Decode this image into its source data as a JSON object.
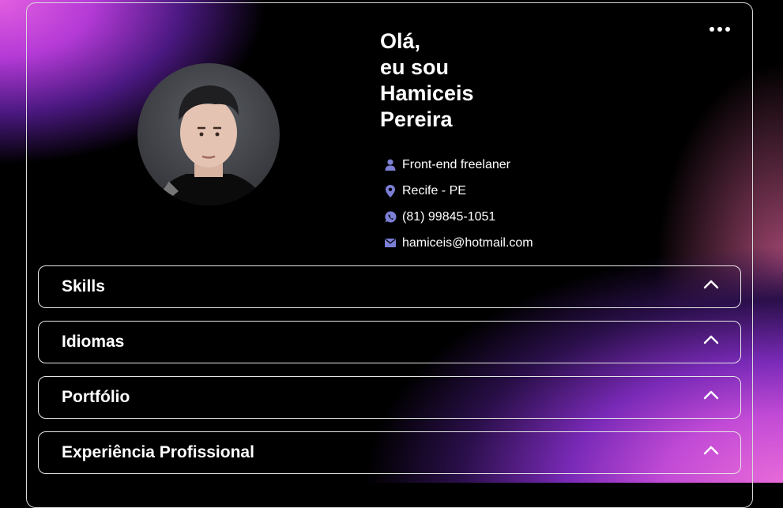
{
  "profile": {
    "greeting_lines": [
      "Olá,",
      "eu sou",
      "Hamiceis",
      "Pereira"
    ],
    "info": [
      {
        "icon": "person-icon",
        "text": "Front-end freelaner"
      },
      {
        "icon": "location-pin-icon",
        "text": "Recife - PE"
      },
      {
        "icon": "whatsapp-icon",
        "text": "(81) 99845-1051"
      },
      {
        "icon": "mail-icon",
        "text": "hamiceis@hotmail.com"
      }
    ]
  },
  "sections": [
    {
      "label": "Skills"
    },
    {
      "label": "Idiomas"
    },
    {
      "label": "Portfólio"
    },
    {
      "label": "Experiência Profissional"
    }
  ],
  "colors": {
    "icon": "#7b7fd6",
    "border": "#e6e6e6",
    "accent_pink": "#e25ee0"
  },
  "menu": {
    "icon": "more-horizontal-icon"
  }
}
